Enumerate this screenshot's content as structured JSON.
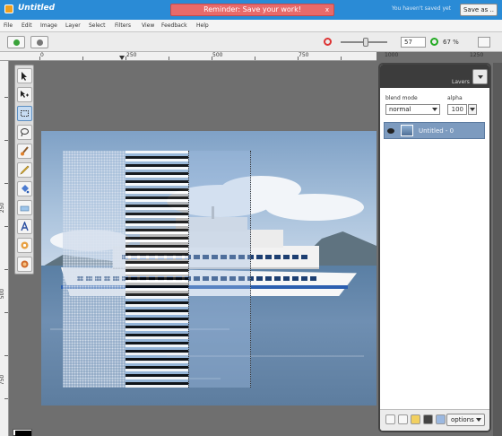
{
  "titlebar": {
    "app_title": "Untitled",
    "reminder": "Reminder: Save your work!",
    "reminder_close": "x",
    "save_note": "You haven't saved yet",
    "save_button": "Save as .."
  },
  "menu": [
    "File",
    "Edit",
    "Image",
    "Layer",
    "Select",
    "Filters",
    "View",
    "Feedback",
    "Help"
  ],
  "toolbar": {
    "zoom_value": "57",
    "zoom_percent": "67 %",
    "zoom_slider_fraction": 0.55
  },
  "rulers": {
    "top_labels": [
      "0",
      "250",
      "500",
      "750",
      "1000",
      "1250"
    ],
    "left_labels": [
      "250",
      "500",
      "750"
    ]
  },
  "tools": [
    "pointer",
    "move",
    "rect-select",
    "lasso",
    "brush",
    "pencil",
    "fill",
    "eraser",
    "text",
    "stamp",
    "smudge"
  ],
  "layers_panel": {
    "title": "Lavers",
    "blend_label": "blend mode",
    "blend_value": "normal",
    "alpha_label": "alpha",
    "alpha_value": "100",
    "layer_name": "Untitled - 0",
    "options_button": "options"
  },
  "colors": {
    "titlebar": "#2a8bd6",
    "reminder": "#e86a6a",
    "layer_selected": "#7d9bbf"
  }
}
